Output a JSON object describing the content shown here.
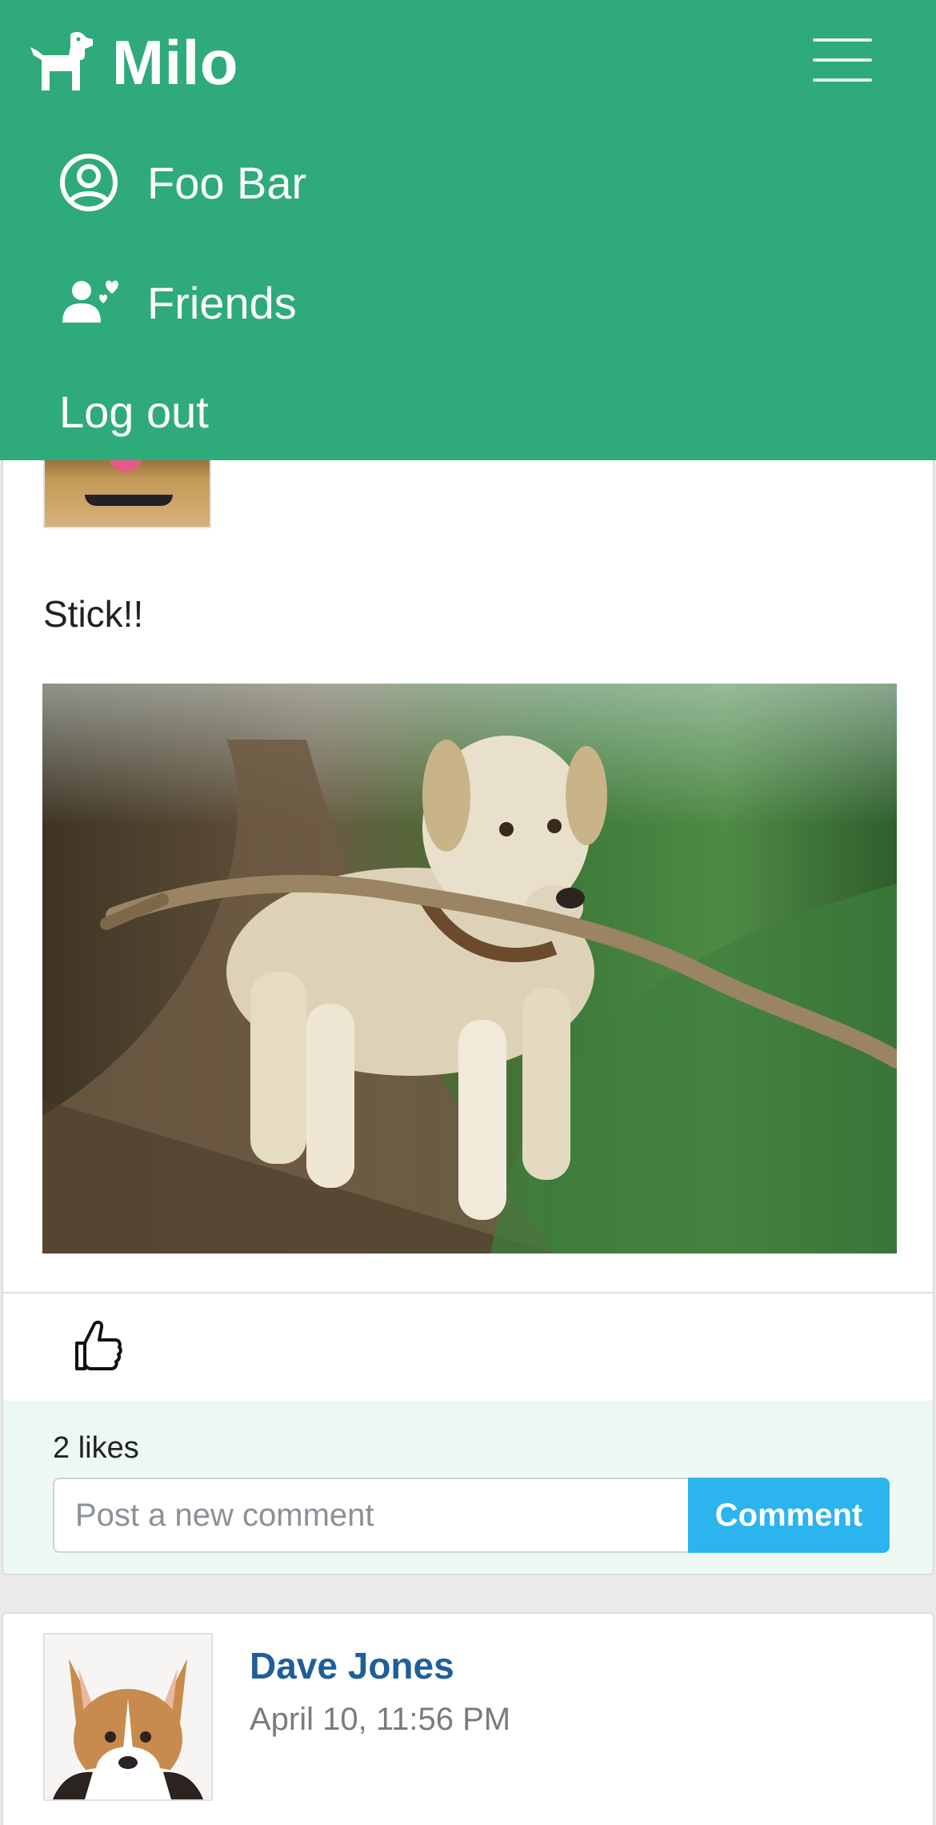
{
  "brand": {
    "name": "Milo",
    "logo_icon": "dog-icon"
  },
  "menu": {
    "icon": "hamburger-icon"
  },
  "nav": {
    "profile": {
      "label": "Foo Bar",
      "icon": "user-circle-icon"
    },
    "friends": {
      "label": "Friends",
      "icon": "friends-icon"
    },
    "logout": {
      "label": "Log out"
    }
  },
  "posts": [
    {
      "text": "Stick!!",
      "photo_alt": "dog-with-stick-photo",
      "likes": "2 likes",
      "comment_placeholder": "Post a new comment",
      "comment_button": "Comment"
    },
    {
      "author": "Dave Jones",
      "time": "April 10, 11:56 PM"
    }
  ],
  "colors": {
    "navbar": "#2eaa7b",
    "comment_button": "#2bb4ee",
    "author_link": "#1f5e9a",
    "comment_area": "#edf8f3"
  }
}
